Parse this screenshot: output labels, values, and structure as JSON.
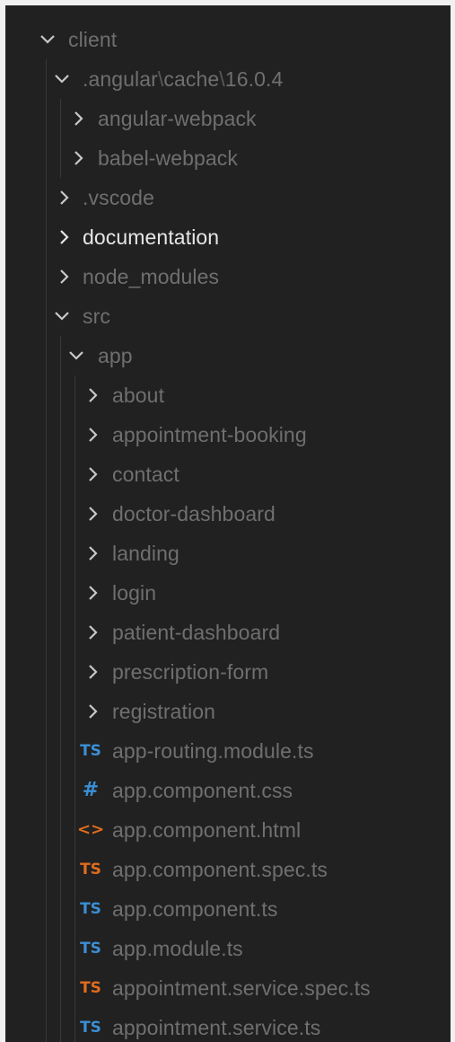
{
  "tree": {
    "client": "client",
    "angular_path": {
      "part1": ".angular",
      "sep1": "\\",
      "part2": "cache",
      "sep2": "\\",
      "part3": "16.0.4"
    },
    "angular_webpack": "angular-webpack",
    "babel_webpack": "babel-webpack",
    "vscode": ".vscode",
    "documentation": "documentation",
    "node_modules": "node_modules",
    "src": "src",
    "app": "app",
    "app_folders": [
      "about",
      "appointment-booking",
      "contact",
      "doctor-dashboard",
      "landing",
      "login",
      "patient-dashboard",
      "prescription-form",
      "registration"
    ],
    "app_files": [
      {
        "name": "app-routing.module.ts",
        "icon": "typescript-icon",
        "icon_text": "TS"
      },
      {
        "name": "app.component.css",
        "icon": "css-hash-icon",
        "icon_text": "#"
      },
      {
        "name": "app.component.html",
        "icon": "html-brackets-icon",
        "icon_text": "<>"
      },
      {
        "name": "app.component.spec.ts",
        "icon": "typescript-spec-icon",
        "icon_text": "TS"
      },
      {
        "name": "app.component.ts",
        "icon": "typescript-icon",
        "icon_text": "TS"
      },
      {
        "name": "app.module.ts",
        "icon": "typescript-icon",
        "icon_text": "TS"
      },
      {
        "name": "appointment.service.spec.ts",
        "icon": "typescript-spec-icon",
        "icon_text": "TS"
      },
      {
        "name": "appointment.service.ts",
        "icon": "typescript-icon",
        "icon_text": "TS"
      }
    ]
  },
  "colors": {
    "background": "#212121",
    "text_dim": "#6f6f6f",
    "text_bright": "#e6e6e6",
    "ts_blue": "#3b8fd6",
    "ts_spec_orange": "#e06c1e",
    "indent_guide": "#383838"
  }
}
